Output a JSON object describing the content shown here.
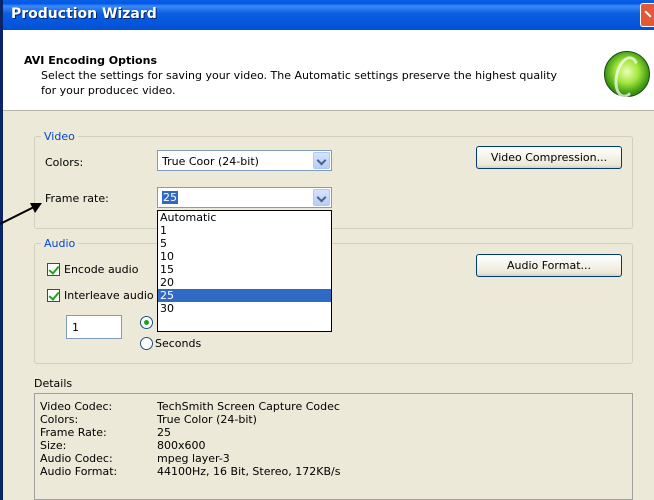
{
  "window": {
    "title": "Production Wizard"
  },
  "header": {
    "title": "AVI Encoding Options",
    "description": "Select the settings for saving your video.  The Automatic settings preserve the highest quality for your producec video."
  },
  "video": {
    "group_label": "Video",
    "colors_label": "Colors:",
    "colors_value": "True Coor (24-bit)",
    "frame_rate_label": "Frame rate:",
    "frame_rate_value": "25",
    "compression_button": "Video Compression..."
  },
  "frame_rate_options": {
    "items": [
      "Automatic",
      "1",
      "5",
      "10",
      "15",
      "20",
      "25",
      "30"
    ],
    "selected": "25"
  },
  "audio": {
    "group_label": "Audio",
    "encode_label": "Encode audio",
    "encode_checked": true,
    "interleave_label": "Interleave audio",
    "interleave_checked": true,
    "interleave_value": "1",
    "seconds_label": "Seconds",
    "format_button": "Audio Format..."
  },
  "details": {
    "label": "Details",
    "rows": [
      {
        "key": "Video Codec:",
        "value": "TechSmith Screen Capture Codec"
      },
      {
        "key": "Colors:",
        "value": "True Color (24-bit)"
      },
      {
        "key": "Frame Rate:",
        "value": "25"
      },
      {
        "key": "Size:",
        "value": "800x600"
      },
      {
        "key": "Audio Codec:",
        "value": "mpeg layer-3"
      },
      {
        "key": "Audio Format:",
        "value": "44100Hz, 16 Bit, Stereo, 172KB/s"
      }
    ]
  },
  "colors": {
    "titlebar": "#0a5fe0",
    "selection": "#316ac5",
    "group_label": "#0046d5",
    "dialog_bg": "#ece9d8"
  }
}
